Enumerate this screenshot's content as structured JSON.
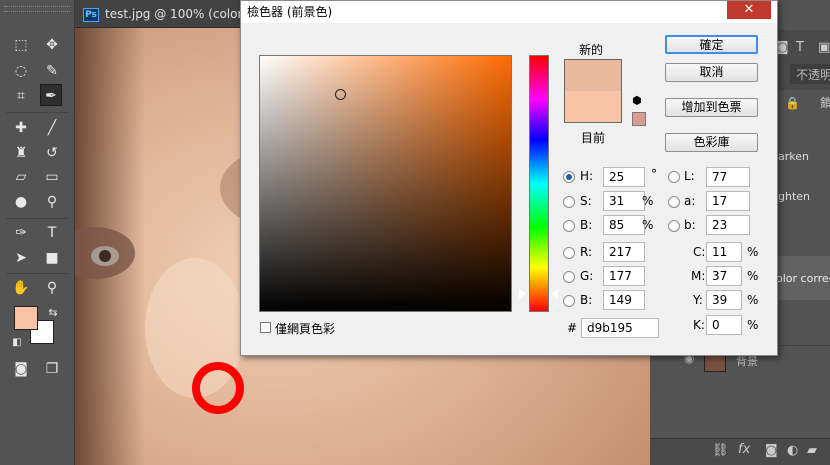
{
  "document": {
    "tab_title": "test.jpg @ 100% (color co",
    "ps_badge": "Ps"
  },
  "colors": {
    "new": "#e8b99c",
    "current": "#f6c3a4",
    "foreground": "#f6c3a4",
    "background": "#ffffff",
    "gamut_swatch": "#d89c90"
  },
  "layers_panel": {
    "opacity_label": "不透明",
    "lock_char": "鎖",
    "items": [
      "arken",
      "ghten",
      "olor correc",
      "背景"
    ]
  },
  "dialog": {
    "title": "檢色器 (前景色)",
    "close_label": "✕",
    "new_label": "新的",
    "current_label": "目前",
    "buttons": {
      "ok": "確定",
      "cancel": "取消",
      "add_swatches": "增加到色票",
      "libraries": "色彩庫"
    },
    "web_only_label": "僅網頁色彩",
    "hsb": [
      {
        "label": "H:",
        "value": "25",
        "unit": "°"
      },
      {
        "label": "S:",
        "value": "31",
        "unit": "%"
      },
      {
        "label": "B:",
        "value": "85",
        "unit": "%"
      }
    ],
    "rgb": [
      {
        "label": "R:",
        "value": "217"
      },
      {
        "label": "G:",
        "value": "177"
      },
      {
        "label": "B:",
        "value": "149"
      }
    ],
    "lab": [
      {
        "label": "L:",
        "value": "77"
      },
      {
        "label": "a:",
        "value": "17"
      },
      {
        "label": "b:",
        "value": "23"
      }
    ],
    "cmyk": [
      {
        "label": "C:",
        "value": "11",
        "unit": "%"
      },
      {
        "label": "M:",
        "value": "37",
        "unit": "%"
      },
      {
        "label": "Y:",
        "value": "39",
        "unit": "%"
      },
      {
        "label": "K:",
        "value": "0",
        "unit": "%"
      }
    ],
    "hex_label": "#",
    "hex_value": "d9b195"
  }
}
